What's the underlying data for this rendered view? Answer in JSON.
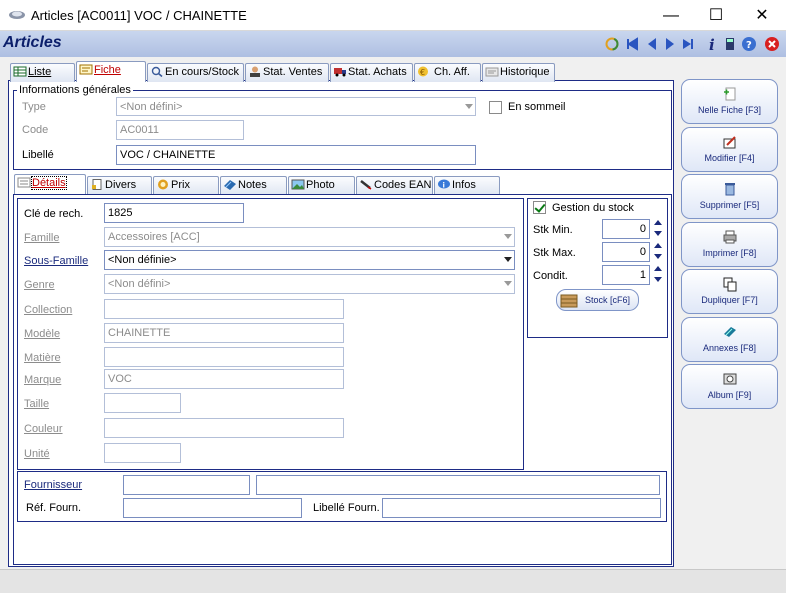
{
  "window": {
    "title": "Articles  [AC0011] VOC / CHAINETTE",
    "minimize": "—",
    "maximize": "☐",
    "close": "✕"
  },
  "header": {
    "title": "Articles"
  },
  "main_tabs": [
    "Liste",
    "Fiche",
    "En cours/Stock",
    "Stat. Ventes",
    "Stat. Achats",
    "Ch. Aff.",
    "Historique"
  ],
  "general": {
    "legend": "Informations générales",
    "type_label": "Type",
    "type_value": "<Non défini>",
    "code_label": "Code",
    "code_value": "AC0011",
    "libelle_label": "Libellé",
    "libelle_value": "VOC / CHAINETTE",
    "sommeil_label": "En sommeil"
  },
  "sub_tabs": [
    "Détails",
    "Divers",
    "Prix",
    "Notes",
    "Photo",
    "Codes EAN",
    "Infos"
  ],
  "details": {
    "cle_label": "Clé de rech.",
    "cle_value": "1825",
    "famille_label": "Famille",
    "famille_value": "Accessoires [ACC]",
    "sousfamille_label": "Sous-Famille",
    "sousfamille_value": "<Non définie>",
    "genre_label": "Genre",
    "genre_value": "<Non défini>",
    "collection_label": "Collection",
    "collection_value": "",
    "modele_label": "Modèle",
    "modele_value": "CHAINETTE",
    "matiere_label": "Matière",
    "matiere_value": "",
    "marque_label": "Marque",
    "marque_value": "VOC",
    "taille_label": "Taille",
    "taille_value": "",
    "couleur_label": "Couleur",
    "couleur_value": "",
    "unite_label": "Unité",
    "unite_value": ""
  },
  "stock": {
    "gestion_label": "Gestion du stock",
    "min_label": "Stk Min.",
    "min_value": "0",
    "max_label": "Stk Max.",
    "max_value": "0",
    "condit_label": "Condit.",
    "condit_value": "1",
    "stock_button": "Stock [cF6]"
  },
  "fournisseur": {
    "label": "Fournisseur",
    "code": "",
    "name": "",
    "ref_label": "Réf. Fourn.",
    "ref_value": "",
    "libelle_label": "Libellé Fourn.",
    "libelle_value": ""
  },
  "side_buttons": [
    "Nelle Fiche [F3]",
    "Modifier [F4]",
    "Supprimer [F5]",
    "Imprimer [F8]",
    "Dupliquer [F7]",
    "Annexes [F8]",
    "Album [F9]"
  ],
  "colors": {
    "accent": "#1a2a7c",
    "header_bg": "#b9c8e8"
  }
}
